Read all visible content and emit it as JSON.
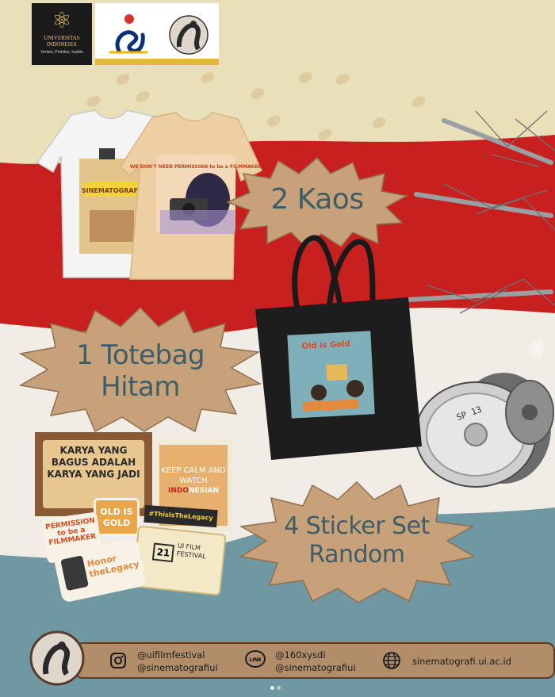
{
  "logos": {
    "university_name": "UNIVERSITAS INDONESIA",
    "university_motto": "Veritas, Probitas, Iustitia"
  },
  "prizes": {
    "shirts": "2 Kaos",
    "totebag_line1": "1 Totebag",
    "totebag_line2": "Hitam",
    "stickers_line1": "4 Sticker Set",
    "stickers_line2": "Random"
  },
  "shirt_designs": {
    "white_shirt": "SINEMATOGRAFI",
    "beige_shirt": "WE DON'T NEED PERMISSION to be a FILMMAKER"
  },
  "totebag_design": {
    "title": "Old is Gold"
  },
  "stickers": {
    "quote": "KARYA YANG BAGUS ADALAH KARYA YANG JADI",
    "keep_calm": "KEEP CALM AND WATCH",
    "indo": "INDO",
    "nesian": "NESIAN",
    "old_gold": "OLD IS GOLD",
    "permission": "PERMISSION to be a FILMMAKER",
    "legacy": "#ThisIsTheLegacy",
    "legacy_sticker": "Honor theLegacy",
    "ticket_num": "21",
    "ticket_text": "UI FILM FESTIVAL"
  },
  "film_reel": {
    "label": "SP 13"
  },
  "footer": {
    "instagram_1": "@uifilmfestival",
    "instagram_2": "@sinematografiui",
    "line_1": "@160xysdi",
    "line_2": "@sinematografiui",
    "line_label": "LINE",
    "website": "sinematografi.ui.ac.id"
  },
  "colors": {
    "cream": "#e9dfb8",
    "red": "#c8201f",
    "teal": "#6f98a3",
    "burst": "#c7a17a",
    "label_text": "#3f5d66"
  },
  "icons": [
    "instagram-icon",
    "line-icon",
    "globe-icon",
    "chevron-right-icon"
  ]
}
